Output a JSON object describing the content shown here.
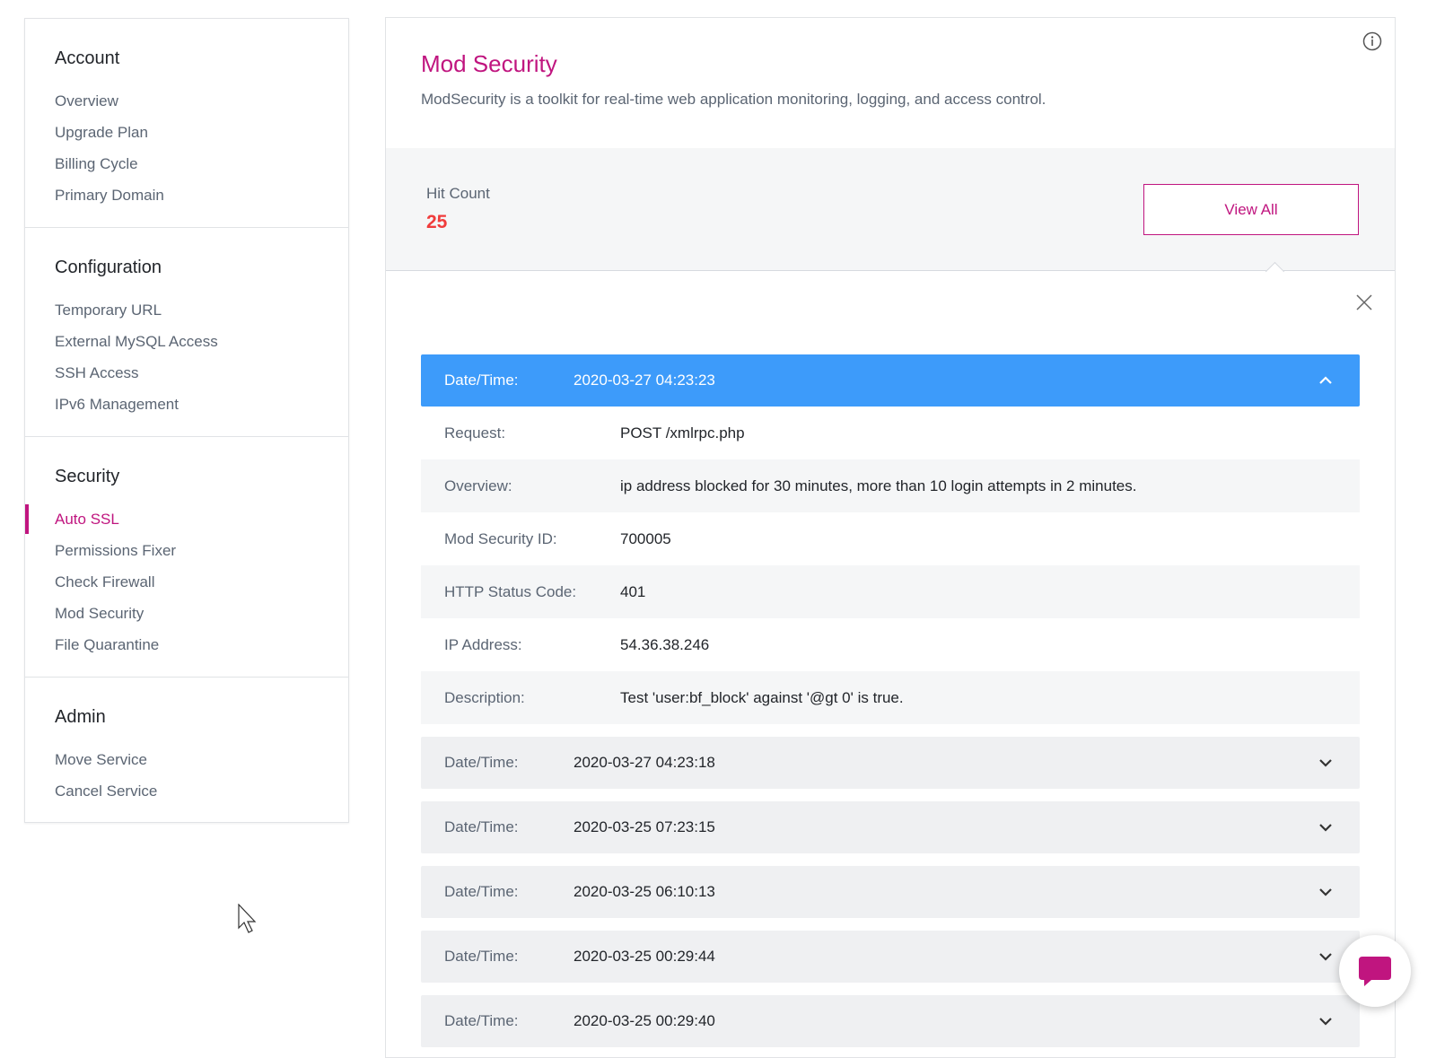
{
  "sidebar": {
    "sections": [
      {
        "heading": "Account",
        "items": [
          {
            "label": "Overview"
          },
          {
            "label": "Upgrade Plan"
          },
          {
            "label": "Billing Cycle"
          },
          {
            "label": "Primary Domain"
          }
        ]
      },
      {
        "heading": "Configuration",
        "items": [
          {
            "label": "Temporary URL"
          },
          {
            "label": "External MySQL Access"
          },
          {
            "label": "SSH Access"
          },
          {
            "label": "IPv6 Management"
          }
        ]
      },
      {
        "heading": "Security",
        "items": [
          {
            "label": "Auto SSL",
            "active": true
          },
          {
            "label": "Permissions Fixer"
          },
          {
            "label": "Check Firewall"
          },
          {
            "label": "Mod Security"
          },
          {
            "label": "File Quarantine"
          }
        ]
      },
      {
        "heading": "Admin",
        "items": [
          {
            "label": "Move Service"
          },
          {
            "label": "Cancel Service"
          }
        ]
      }
    ]
  },
  "main": {
    "title": "Mod Security",
    "subtitle": "ModSecurity is a toolkit for real-time web application monitoring, logging, and access control.",
    "hit_count_label": "Hit Count",
    "hit_count_value": "25",
    "view_all_label": "View All"
  },
  "entries": [
    {
      "label": "Date/Time:",
      "value": "2020-03-27 04:23:23",
      "open": true,
      "details": [
        {
          "key": "Request:",
          "value": "POST /xmlrpc.php"
        },
        {
          "key": "Overview:",
          "value": "ip address blocked for 30 minutes, more than 10 login attempts in 2 minutes."
        },
        {
          "key": "Mod Security ID:",
          "value": "700005"
        },
        {
          "key": "HTTP Status Code:",
          "value": "401"
        },
        {
          "key": "IP Address:",
          "value": "54.36.38.246"
        },
        {
          "key": "Description:",
          "value": "Test 'user:bf_block' against '@gt 0' is true."
        }
      ]
    },
    {
      "label": "Date/Time:",
      "value": "2020-03-27 04:23:18",
      "open": false
    },
    {
      "label": "Date/Time:",
      "value": "2020-03-25 07:23:15",
      "open": false
    },
    {
      "label": "Date/Time:",
      "value": "2020-03-25 06:10:13",
      "open": false
    },
    {
      "label": "Date/Time:",
      "value": "2020-03-25 00:29:44",
      "open": false
    },
    {
      "label": "Date/Time:",
      "value": "2020-03-25 00:29:40",
      "open": false
    }
  ],
  "colors": {
    "brand": "#c0157f",
    "accent_open": "#3d9bfa",
    "hit_count": "#f03c3c"
  },
  "icons": {
    "info": "info-icon",
    "close": "close-icon",
    "expand": "chevron-down-icon",
    "collapse": "chevron-up-icon",
    "chat": "chat-bubble-icon"
  }
}
